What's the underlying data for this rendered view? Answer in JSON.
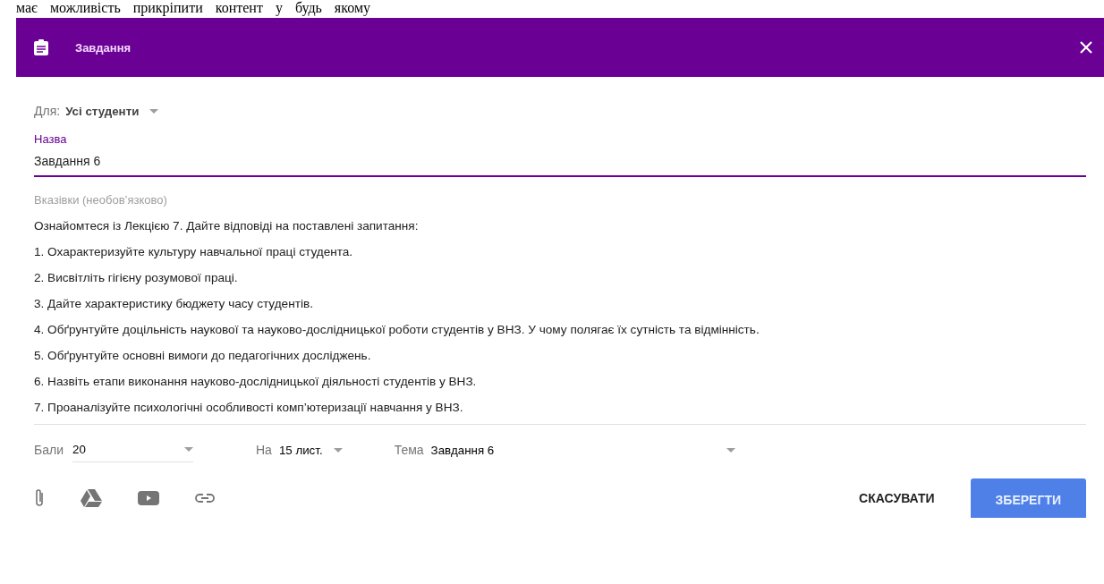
{
  "document_text": "має можливість прикріпити контент у будь якому",
  "dialog": {
    "title": "Завдання",
    "for": {
      "label": "Для:",
      "value": "Усі студенти"
    },
    "title_field": {
      "label": "Назва",
      "value": "Завдання 6"
    },
    "instructions": {
      "label": "Вказівки (необов’язково)",
      "lines": [
        "Ознайомтеся із Лекцією 7. Дайте відповіді на поставлені запитання:",
        "1. Охарактеризуйте культуру навчальної праці студента.",
        "2. Висвітліть гігієну розумової праці.",
        "3. Дайте характеристику бюджету часу студентів.",
        "4. Обґрунтуйте доцільність наукової та науково-дослідницької роботи студентів у ВНЗ. У чому полягає їх сутність та відмінність.",
        "5. Обґрунтуйте основні вимоги до педагогічних досліджень.",
        "6. Назвіть етапи виконання науково-дослідницької діяльності студентів у ВНЗ.",
        "7. Проаналізуйте психологічні особливості комп’ютеризації навчання у ВНЗ."
      ]
    },
    "points": {
      "label": "Бали",
      "value": "20"
    },
    "due": {
      "label": "На",
      "value": "15 лист."
    },
    "topic": {
      "label": "Тема",
      "value": "Завдання 6"
    },
    "buttons": {
      "cancel": "СКАСУВАТИ",
      "save": "ЗБЕРЕГТИ"
    }
  }
}
